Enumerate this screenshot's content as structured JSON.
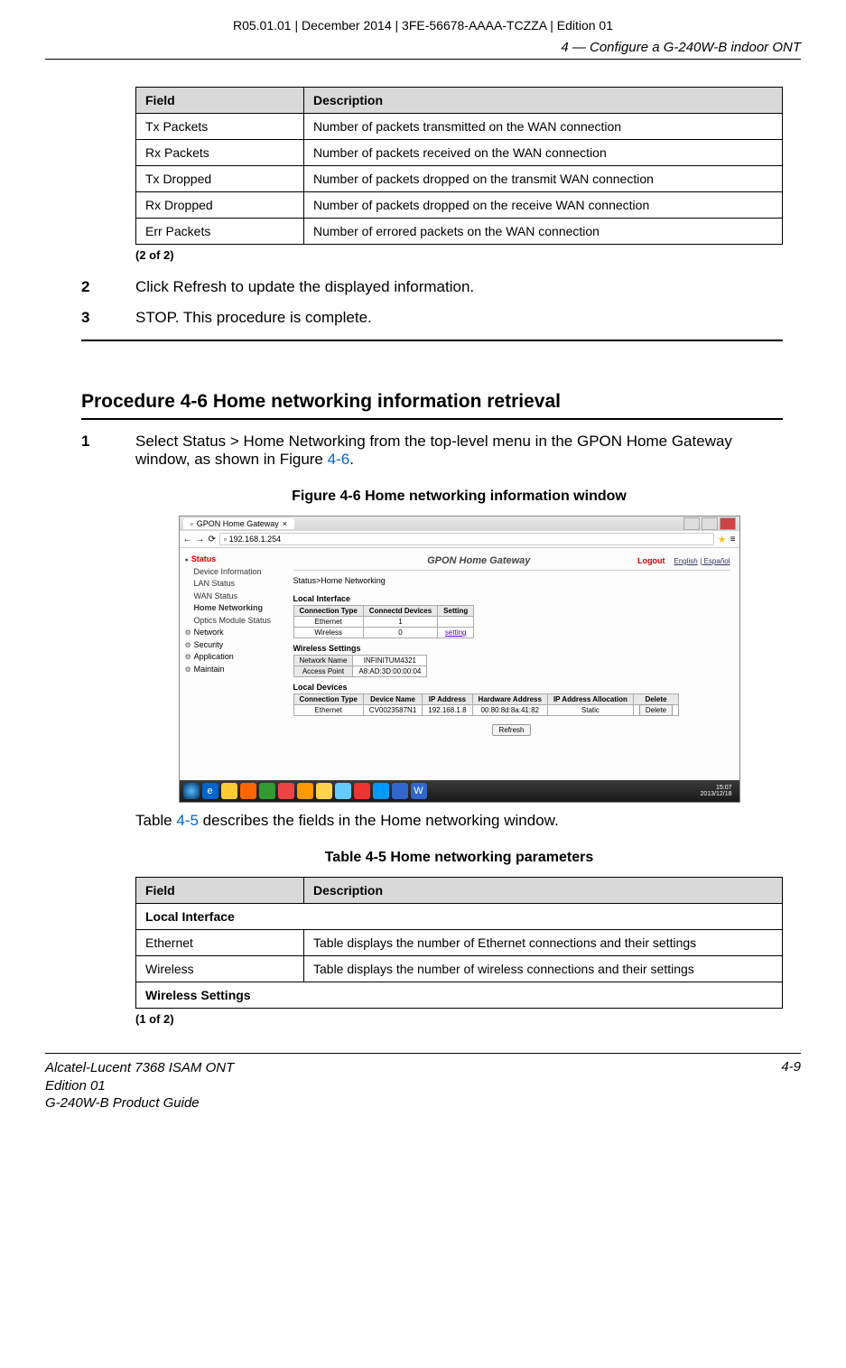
{
  "header": {
    "doc_info": "R05.01.01 | December 2014 | 3FE-56678-AAAA-TCZZA | Edition 01",
    "chapter": "4 —  Configure a G-240W-B indoor ONT"
  },
  "table1": {
    "cols": [
      "Field",
      "Description"
    ],
    "rows": [
      [
        "Tx Packets",
        "Number of packets transmitted on the WAN connection"
      ],
      [
        "Rx Packets",
        "Number of packets received on the WAN connection"
      ],
      [
        "Tx Dropped",
        "Number of packets dropped on the transmit WAN connection"
      ],
      [
        "Rx Dropped",
        "Number of packets dropped on the receive WAN connection"
      ],
      [
        "Err Packets",
        "Number of errored packets on the WAN connection"
      ]
    ],
    "page_note": "(2 of 2)"
  },
  "steps_a": [
    {
      "num": "2",
      "text": "Click Refresh to update the displayed information."
    },
    {
      "num": "3",
      "text": "STOP. This procedure is complete."
    }
  ],
  "procedure_title": "Procedure 4-6  Home networking information retrieval",
  "step1": {
    "num": "1",
    "text_pre": "Select Status > Home Networking from the top-level menu in the GPON Home Gateway window, as shown in Figure ",
    "fig_link": "4-6",
    "text_post": "."
  },
  "figure_caption": "Figure 4-6  Home networking information window",
  "screenshot": {
    "tab_title": "GPON Home Gateway",
    "url": "192.168.1.254",
    "brand_title": "GPON Home Gateway",
    "logout": "Logout",
    "lang1": "English",
    "lang2": "Español",
    "breadcrumb": "Status>Home Networking",
    "side": {
      "status": "Status",
      "items1": [
        "Device Information",
        "LAN Status",
        "WAN Status"
      ],
      "home_net": "Home Networking",
      "items2": [
        "Optics Module Status"
      ],
      "gears": [
        "Network",
        "Security",
        "Application",
        "Maintain"
      ]
    },
    "local_interface": {
      "title": "Local Interface",
      "cols": [
        "Connection Type",
        "Connectd Devices",
        "Setting"
      ],
      "rows": [
        [
          "Ethernet",
          "1",
          ""
        ],
        [
          "Wireless",
          "0",
          "setting"
        ]
      ]
    },
    "wireless_settings": {
      "title": "Wireless Settings",
      "rows": [
        [
          "Network Name",
          "INFINITUM4321"
        ],
        [
          "Access Point",
          "A8:AD:3D:00:00:04"
        ]
      ]
    },
    "local_devices": {
      "title": "Local Devices",
      "cols": [
        "Connection Type",
        "Device Name",
        "IP Address",
        "Hardware Address",
        "IP Address Allocation",
        "Delete"
      ],
      "rows": [
        [
          "Ethernet",
          "CV0023587N1",
          "192.168.1.8",
          "00:80:8d:8a:41:82",
          "Static",
          "Delete"
        ]
      ]
    },
    "refresh": "Refresh",
    "clock": {
      "time": "15:07",
      "date": "2013/12/18"
    }
  },
  "after_fig": {
    "pre": "Table ",
    "link": "4-5",
    "post": " describes the fields in the Home networking window."
  },
  "table2": {
    "caption": "Table 4-5 Home networking parameters",
    "cols": [
      "Field",
      "Description"
    ],
    "sections": [
      {
        "header": "Local Interface",
        "rows": [
          [
            "Ethernet",
            "Table displays the number of Ethernet connections and their settings"
          ],
          [
            "Wireless",
            "Table displays the number of wireless connections and their settings"
          ]
        ]
      },
      {
        "header": "Wireless Settings",
        "rows": []
      }
    ],
    "page_note": "(1 of 2)"
  },
  "footer": {
    "line1": "Alcatel-Lucent 7368 ISAM ONT",
    "line2": "Edition 01",
    "line3": "G-240W-B Product Guide",
    "page": "4-9"
  }
}
